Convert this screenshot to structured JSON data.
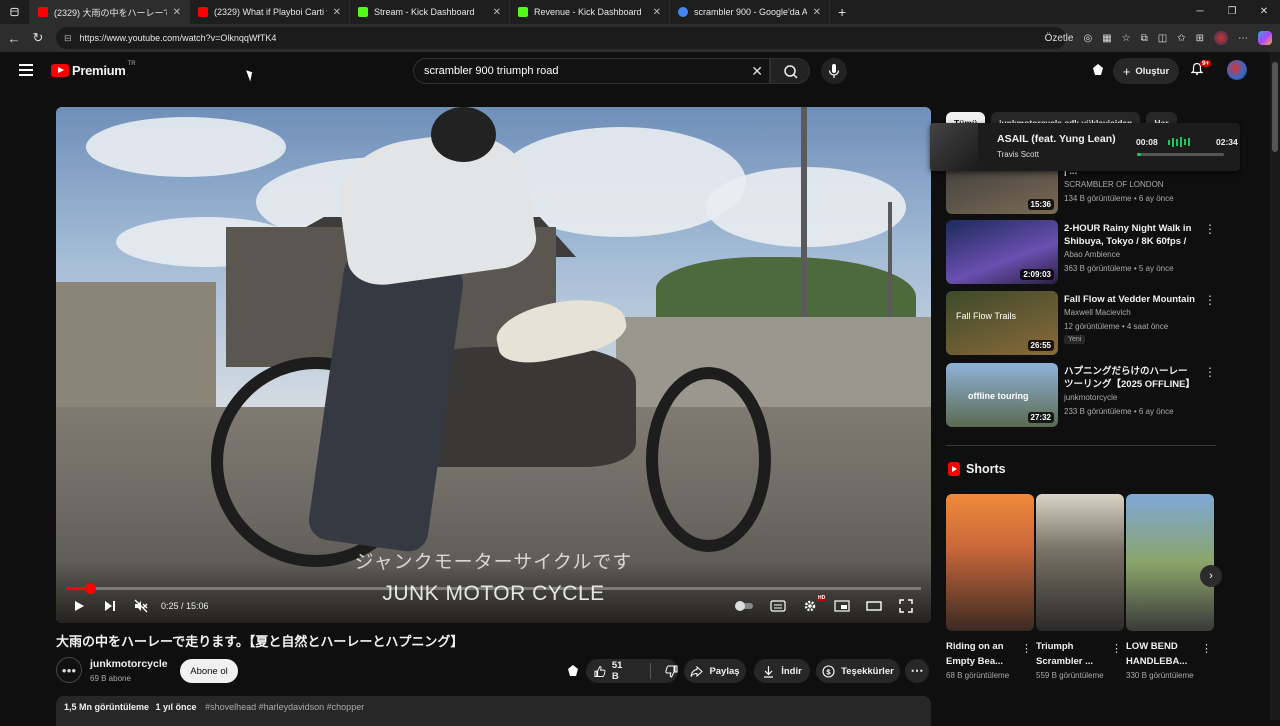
{
  "browser": {
    "tabs": [
      {
        "title": "(2329) 大雨の中をハーレーで走ります。",
        "favicon_color": "#ff0000",
        "active": true
      },
      {
        "title": "(2329) What if Playboi Carti was p",
        "favicon_color": "#ff0000",
        "active": false
      },
      {
        "title": "Stream - Kick Dashboard",
        "favicon_color": "#53fc18",
        "active": false
      },
      {
        "title": "Revenue - Kick Dashboard",
        "favicon_color": "#53fc18",
        "active": false
      },
      {
        "title": "scrambler 900 - Google'da Ara",
        "favicon_color": "#4285f4",
        "active": false
      }
    ],
    "new_tab": "+",
    "url": "https://www.youtube.com/watch?v=OlknqqWfTK4",
    "ozetle_label": "Özetle"
  },
  "header": {
    "logo_text": "Premium",
    "logo_country": "TR",
    "search_value": "scrambler 900 triumph road",
    "create_label": "Oluştur",
    "notif_count": "9+"
  },
  "player": {
    "subtitle_jp": "ジャンクモーターサイクルです",
    "subtitle_en": "JUNK MOTOR CYCLE",
    "time": "0:25 / 15:06",
    "progress": 0.028,
    "hd_badge": "HD"
  },
  "video": {
    "title": "大雨の中をハーレーで走ります。【夏と自然とハーレーとハプニング】",
    "channel": "junkmotorcycle",
    "subscribers": "69 B abone",
    "subscribe_label": "Abone ol",
    "likes": "51 B",
    "share_label": "Paylaş",
    "download_label": "İndir",
    "thanks_label": "Teşekkürler",
    "views": "1,5 Mn görüntüleme",
    "age": "1 yıl önce",
    "tags": "#shovelhead #harleydavidson #chopper"
  },
  "sidebar": {
    "chips": [
      "Tümü",
      "junkmotorcycle adlı yükleyiciden",
      "Har"
    ],
    "media_popup": {
      "song": "ASAIL (feat. Yung Lean)",
      "artist": "Travis Scott",
      "elapsed": "00:08",
      "total": "02:34",
      "progress": 0.05
    },
    "recommendations": [
      {
        "title": "Ride Through London | POV | ...",
        "channel": "SCRAMBLER OF LONDON",
        "meta": "134 B görüntüleme • 6 ay önce",
        "duration": "15:36",
        "new": "",
        "thumb": [
          "#3a3a3a",
          "#7a6a55"
        ]
      },
      {
        "title": "2-HOUR Rainy Night Walk in Shibuya, Tokyo / 8K 60fps / ...",
        "channel": "Abao Ambience",
        "meta": "363 B görüntüleme • 5 ay önce",
        "duration": "2:09:03",
        "new": "",
        "thumb": [
          "#1b2a5a",
          "#6a4fb0"
        ]
      },
      {
        "title": "Fall Flow at Vedder Mountain",
        "channel": "Maxwell Macievich",
        "meta": "12 görüntüleme • 4 saat önce",
        "duration": "26:55",
        "new": "Yeni",
        "thumb": [
          "#3d4a2a",
          "#8a6a3a"
        ],
        "thumb_text": "Fall Flow Trails"
      },
      {
        "title": "ハプニングだらけのハーレーツーリング【2025 OFFLINE】",
        "channel": "junkmotorcycle",
        "meta": "233 B görüntüleme • 6 ay önce",
        "duration": "27:32",
        "new": "",
        "thumb": [
          "#8fb3d8",
          "#5a6a50"
        ],
        "thumb_text": "offline touring"
      }
    ],
    "shorts_title": "Shorts",
    "shorts": [
      {
        "title": "Riding on an Empty Bea...",
        "views": "68 B görüntüleme",
        "thumb": [
          "#f08a3a",
          "#3a2a22"
        ]
      },
      {
        "title": "Triumph Scrambler ...",
        "views": "559 B görüntüleme",
        "thumb": [
          "#c9c4b8",
          "#2a2a2a"
        ]
      },
      {
        "title": "LOW BEND HANDLEBA...",
        "views": "330 B görüntüleme",
        "thumb": [
          "#7fa8d6",
          "#3a3a3a"
        ]
      }
    ]
  }
}
